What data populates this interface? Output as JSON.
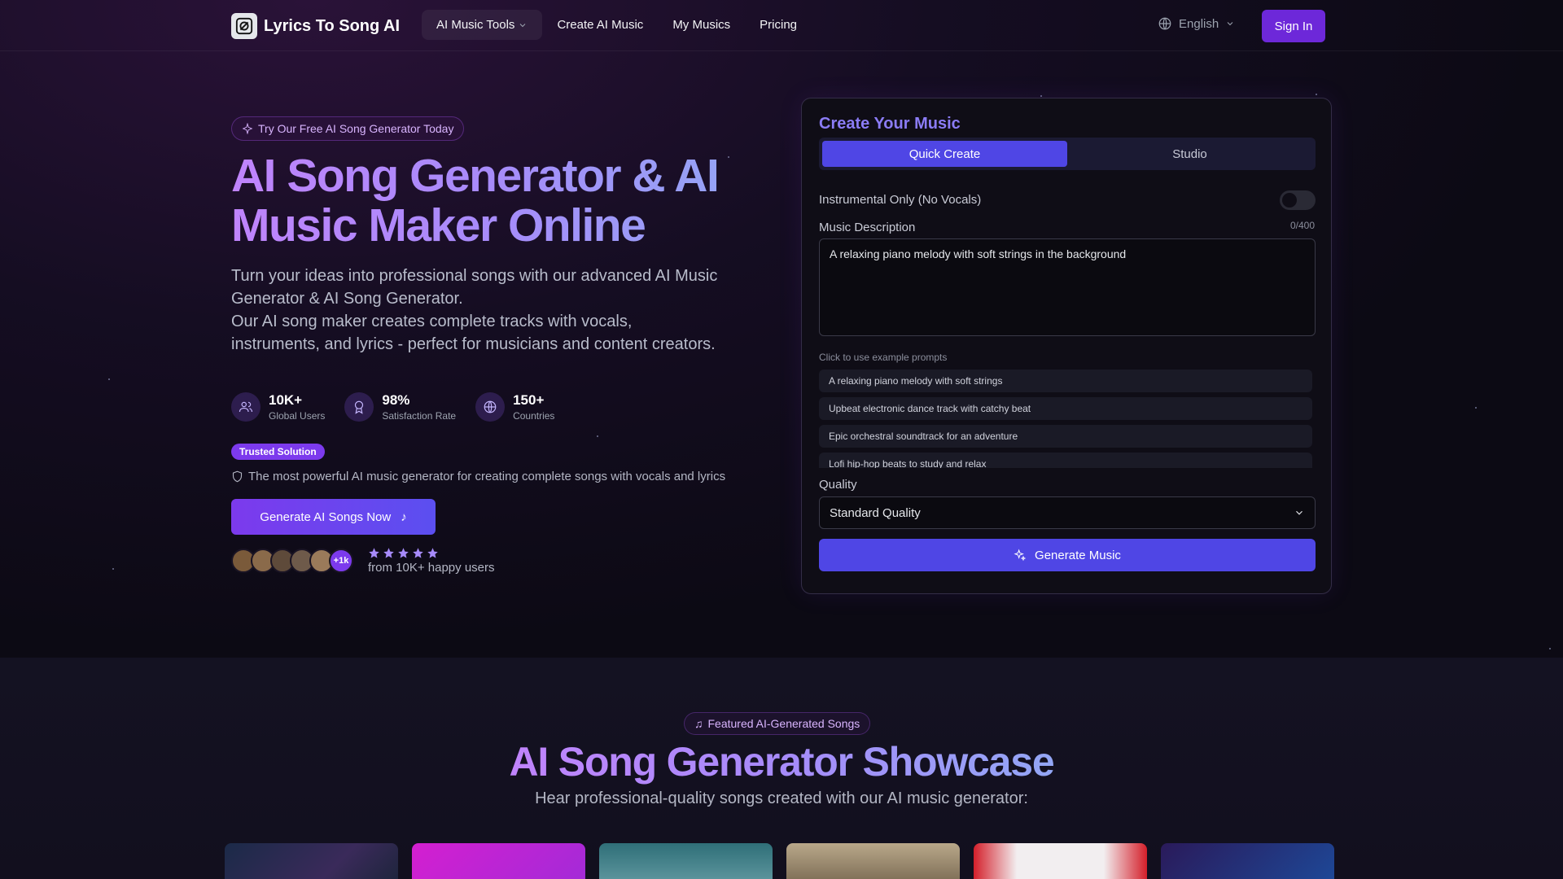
{
  "nav": {
    "brand": "Lyrics To Song AI",
    "links": [
      {
        "label": "AI Music Tools"
      },
      {
        "label": "Create AI Music"
      },
      {
        "label": "My Musics"
      },
      {
        "label": "Pricing"
      }
    ],
    "language": "English",
    "sign_in": "Sign In"
  },
  "hero": {
    "pill": "Try Our Free AI Song Generator Today",
    "title": "AI Song Generator & AI Music Maker Online",
    "desc_1": "Turn your ideas into professional songs with our advanced AI Music Generator & AI Song Generator.",
    "desc_2": "Our AI song maker creates complete tracks with vocals, instruments, and lyrics - perfect for musicians and content creators.",
    "stats": [
      {
        "value": "10K+",
        "label": "Global Users",
        "icon": "users-icon"
      },
      {
        "value": "98%",
        "label": "Satisfaction Rate",
        "icon": "award-icon"
      },
      {
        "value": "150+",
        "label": "Countries",
        "icon": "globe-icon"
      }
    ],
    "badge": "Trusted Solution",
    "trust_line": "The most powerful AI music generator for creating complete songs with vocals and lyrics",
    "cta": "Generate AI Songs Now",
    "avatar_more": "+1k",
    "rating_text": "from 10K+ happy users",
    "rating_stars": 5
  },
  "card": {
    "title": "Create Your Music",
    "tabs": [
      "Quick Create",
      "Studio"
    ],
    "instrumental_label": "Instrumental Only (No Vocals)",
    "desc_label": "Music Description",
    "desc_count": "0/400",
    "desc_value": "A relaxing piano melody with soft strings in the background",
    "examples_label": "Click to use example prompts",
    "examples": [
      "A relaxing piano melody with soft strings",
      "Upbeat electronic dance track with catchy beat",
      "Epic orchestral soundtrack for an adventure",
      "Lofi hip-hop beats to study and relax"
    ],
    "quality_label": "Quality",
    "quality_value": "Standard Quality",
    "generate": "Generate Music"
  },
  "showcase": {
    "pill": "Featured AI-Generated Songs",
    "title": "AI Song Generator Showcase",
    "subtitle": "Hear professional-quality songs created with our AI music generator:"
  },
  "colors": {
    "accent": "#7c3aed",
    "primary_button": "#4f46e5",
    "background": "#0b0a12"
  }
}
